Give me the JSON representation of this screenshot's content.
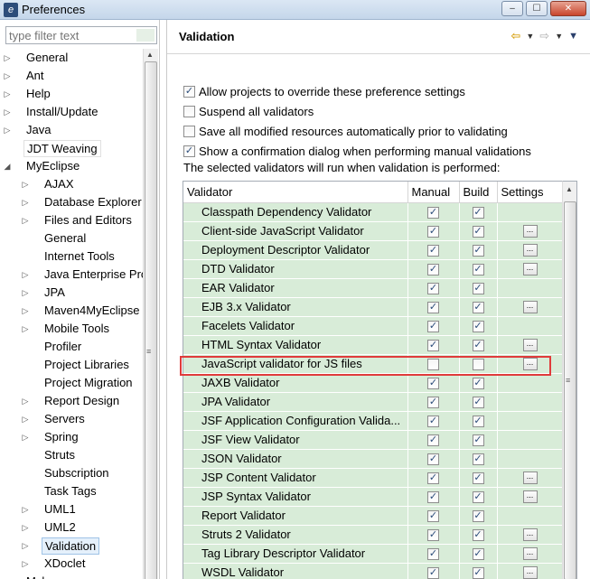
{
  "window": {
    "title": "Preferences",
    "buttons": [
      "–",
      "☐",
      "✕"
    ]
  },
  "filter": {
    "placeholder": "type filter text"
  },
  "tree": [
    {
      "label": "General",
      "level": 0,
      "arrow": "right"
    },
    {
      "label": "Ant",
      "level": 0,
      "arrow": "right"
    },
    {
      "label": "Help",
      "level": 0,
      "arrow": "right"
    },
    {
      "label": "Install/Update",
      "level": 0,
      "arrow": "right"
    },
    {
      "label": "Java",
      "level": 0,
      "arrow": "right"
    },
    {
      "label": "JDT Weaving",
      "level": 0,
      "arrow": "none",
      "boxed": true
    },
    {
      "label": "MyEclipse",
      "level": 0,
      "arrow": "down"
    },
    {
      "label": "AJAX",
      "level": 1,
      "arrow": "right"
    },
    {
      "label": "Database Explorer",
      "level": 1,
      "arrow": "right"
    },
    {
      "label": "Files and Editors",
      "level": 1,
      "arrow": "right"
    },
    {
      "label": "General",
      "level": 1,
      "arrow": "none"
    },
    {
      "label": "Internet Tools",
      "level": 1,
      "arrow": "none"
    },
    {
      "label": "Java Enterprise Pro",
      "level": 1,
      "arrow": "right"
    },
    {
      "label": "JPA",
      "level": 1,
      "arrow": "right"
    },
    {
      "label": "Maven4MyEclipse",
      "level": 1,
      "arrow": "right"
    },
    {
      "label": "Mobile Tools",
      "level": 1,
      "arrow": "right"
    },
    {
      "label": "Profiler",
      "level": 1,
      "arrow": "none"
    },
    {
      "label": "Project Libraries",
      "level": 1,
      "arrow": "none"
    },
    {
      "label": "Project Migration",
      "level": 1,
      "arrow": "none"
    },
    {
      "label": "Report Design",
      "level": 1,
      "arrow": "right"
    },
    {
      "label": "Servers",
      "level": 1,
      "arrow": "right"
    },
    {
      "label": "Spring",
      "level": 1,
      "arrow": "right"
    },
    {
      "label": "Struts",
      "level": 1,
      "arrow": "none"
    },
    {
      "label": "Subscription",
      "level": 1,
      "arrow": "none"
    },
    {
      "label": "Task Tags",
      "level": 1,
      "arrow": "none"
    },
    {
      "label": "UML1",
      "level": 1,
      "arrow": "right"
    },
    {
      "label": "UML2",
      "level": 1,
      "arrow": "right"
    },
    {
      "label": "Validation",
      "level": 1,
      "arrow": "right",
      "selected": true
    },
    {
      "label": "XDoclet",
      "level": 1,
      "arrow": "right"
    },
    {
      "label": "Mylyn",
      "level": 0,
      "arrow": "right"
    }
  ],
  "page": {
    "title": "Validation",
    "checks": [
      {
        "label": "Allow projects to override these preference settings",
        "checked": true
      },
      {
        "label": "Suspend all validators",
        "checked": false
      },
      {
        "label": "Save all modified resources automatically prior to validating",
        "checked": false
      },
      {
        "label": "Show a confirmation dialog when performing manual validations",
        "checked": true
      }
    ],
    "info": "The selected validators will run when validation is performed:"
  },
  "table": {
    "columns": [
      "Validator",
      "Manual",
      "Build",
      "Settings"
    ],
    "settings_button": "...",
    "rows": [
      {
        "name": "Classpath Dependency Validator",
        "manual": true,
        "build": true,
        "settings": false
      },
      {
        "name": "Client-side JavaScript Validator",
        "manual": true,
        "build": true,
        "settings": true
      },
      {
        "name": "Deployment Descriptor Validator",
        "manual": true,
        "build": true,
        "settings": true
      },
      {
        "name": "DTD Validator",
        "manual": true,
        "build": true,
        "settings": true
      },
      {
        "name": "EAR Validator",
        "manual": true,
        "build": true,
        "settings": false
      },
      {
        "name": "EJB 3.x Validator",
        "manual": true,
        "build": true,
        "settings": true
      },
      {
        "name": "Facelets Validator",
        "manual": true,
        "build": true,
        "settings": false
      },
      {
        "name": "HTML Syntax Validator",
        "manual": true,
        "build": true,
        "settings": true
      },
      {
        "name": "JavaScript validator for JS files",
        "manual": false,
        "build": false,
        "settings": true
      },
      {
        "name": "JAXB Validator",
        "manual": true,
        "build": true,
        "settings": false
      },
      {
        "name": "JPA Validator",
        "manual": true,
        "build": true,
        "settings": false
      },
      {
        "name": "JSF Application Configuration Valida...",
        "manual": true,
        "build": true,
        "settings": false
      },
      {
        "name": "JSF View Validator",
        "manual": true,
        "build": true,
        "settings": false
      },
      {
        "name": "JSON Validator",
        "manual": true,
        "build": true,
        "settings": false
      },
      {
        "name": "JSP Content Validator",
        "manual": true,
        "build": true,
        "settings": true
      },
      {
        "name": "JSP Syntax Validator",
        "manual": true,
        "build": true,
        "settings": true
      },
      {
        "name": "Report Validator",
        "manual": true,
        "build": true,
        "settings": false
      },
      {
        "name": "Struts 2 Validator",
        "manual": true,
        "build": true,
        "settings": true
      },
      {
        "name": "Tag Library Descriptor Validator",
        "manual": true,
        "build": true,
        "settings": true
      },
      {
        "name": "WSDL Validator",
        "manual": true,
        "build": true,
        "settings": true
      }
    ]
  },
  "colors": {
    "row_bg": "#d8ecd8",
    "highlight": "#e03b3b",
    "selected_tree": "#e5f0fb"
  }
}
